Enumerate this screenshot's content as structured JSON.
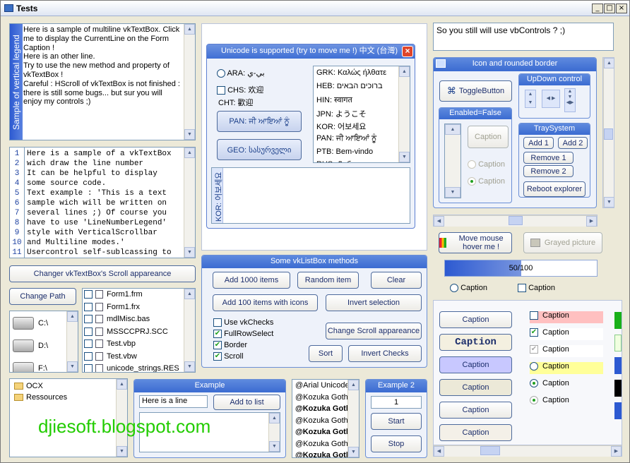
{
  "window": {
    "title": "Tests",
    "min": "_",
    "max": "□",
    "close": "×"
  },
  "vertical_legend": {
    "label": "Sample of vertical legend",
    "text": "Here is a sample of multiline vkTextBox. Click me to display the CurrentLine on the Form Caption !\nHere is an other line.\nTry to use the new method and property of vkTextBox !\nCareful : HScroll of vkTextBox is not finished : there is still some bugs... but sur you will enjoy my controls ;)"
  },
  "code_box": {
    "line_numbers": [
      "1",
      "2",
      "3",
      "4",
      "5",
      "6",
      "7",
      "8",
      "9",
      "10",
      "11"
    ],
    "lines": [
      "Here is a sample of a vkTextBox",
      "wich draw the line number",
      "It can be helpful to display",
      "some source code.",
      "Text example : 'This is a text",
      "sample wich will be written on",
      "several lines ;) Of course you",
      "have to use 'LineNumberLegend'",
      "style with VerticalScrollbar",
      "and Multiline modes.'",
      "Usercontrol self-sublcassing to"
    ]
  },
  "scroll_button": {
    "label": "Changer vkTextBox's Scroll appareance"
  },
  "change_path": {
    "label": "Change Path"
  },
  "drives": [
    {
      "label": "C:\\"
    },
    {
      "label": "D:\\"
    },
    {
      "label": "F:\\"
    }
  ],
  "files": [
    {
      "name": "Form1.frm"
    },
    {
      "name": "Form1.frx"
    },
    {
      "name": "mdlMisc.bas"
    },
    {
      "name": "MSSCCPRJ.SCC"
    },
    {
      "name": "Test.vbp"
    },
    {
      "name": "Test.vbw"
    },
    {
      "name": "unicode_strings.RES"
    }
  ],
  "folders": [
    {
      "name": "OCX"
    },
    {
      "name": "Ressources"
    }
  ],
  "unicode_form": {
    "title": "Unicode is supported (try to move me !)  中文 (台灣)",
    "ara": "ARA: بي-ي",
    "chs": "CHS: 欢迎",
    "cht": "CHT: 歡迎",
    "pan_btn": "PAN: ਜੀ ਆਇਆਂ ਨੂੰ",
    "geo_btn": "GEO: სასურველი",
    "kor_vertical": "KOR: 어보세요",
    "list": [
      "GRK: Καλώς ήλθατε",
      "HEB: ברוכים הבאים",
      "HIN: स्वागत",
      "JPN: ようこそ",
      "KOR: 어보세요",
      "PAN: ਜੀ ਆਇਆਂ ਨੂੰ",
      "PTB: Bem-vindo",
      "RUS: Добро"
    ]
  },
  "listbox_methods": {
    "title": "Some vkListBox methods",
    "add1000": "Add 1000 items",
    "random": "Random item",
    "clear": "Clear",
    "add100": "Add 100 items with icons",
    "invert_sel": "Invert selection",
    "use_vkchecks": "Use vkChecks",
    "fullrowselect": "FullRowSelect",
    "border": "Border",
    "scroll": "Scroll",
    "change_scroll": "Change Scroll appareance",
    "sort": "Sort",
    "invert_checks": "Invert Checks"
  },
  "example": {
    "title": "Example",
    "input_value": "Here is a line",
    "add_button": "Add to list"
  },
  "font_list": [
    {
      "text": "@Arial Unicode"
    },
    {
      "text": "@Kozuka Goth"
    },
    {
      "text": "@Kozuka Goth"
    },
    {
      "text": "@Kozuka Goth"
    },
    {
      "text": "@Kozuka Goth"
    },
    {
      "text": "@Kozuka Goth"
    },
    {
      "text": "@Kozuka Goth"
    }
  ],
  "example2": {
    "title": "Example 2",
    "value": "1",
    "start": "Start",
    "stop": "Stop"
  },
  "vbcontrols": {
    "text": "So you still will use vbControls ? ;)"
  },
  "icon_frame": {
    "title": "Icon and rounded border",
    "toggle": "ToggleButton",
    "enabled_false": "Enabled=False",
    "caption_btn": "Caption",
    "caption1": "Caption",
    "caption2": "Caption",
    "updown_title": "UpDown control",
    "tray_title": "TraySystem",
    "add1": "Add 1",
    "add2": "Add 2",
    "remove1": "Remove 1",
    "remove2": "Remove 2",
    "reboot": "Reboot explorer"
  },
  "mouse_hover": {
    "label": "Move mouse hover me !"
  },
  "grayed": {
    "label": "Grayed picture"
  },
  "progress": {
    "text": "50/100",
    "fraction": 0.5
  },
  "bottom_options": {
    "radio": "Caption",
    "check": "Caption"
  },
  "caption_buttons": [
    "Caption",
    "Caption",
    "Caption",
    "Caption",
    "Caption",
    "Caption"
  ],
  "caption_checks": [
    {
      "label": "Caption",
      "type": "check",
      "state": "off",
      "bg": "#ffc0c0"
    },
    {
      "label": "Caption",
      "type": "check",
      "state": "on",
      "bg": "#ffffff"
    },
    {
      "label": "Caption",
      "type": "check",
      "state": "on-gray",
      "bg": "#ffffff"
    },
    {
      "label": "Caption",
      "type": "radio",
      "state": "off",
      "bg": "#ffff99"
    },
    {
      "label": "Caption",
      "type": "radio",
      "state": "on",
      "bg": ""
    },
    {
      "label": "Caption",
      "type": "radio",
      "state": "on-gray",
      "bg": ""
    }
  ],
  "watermark": "djiesoft.blogspot.com"
}
